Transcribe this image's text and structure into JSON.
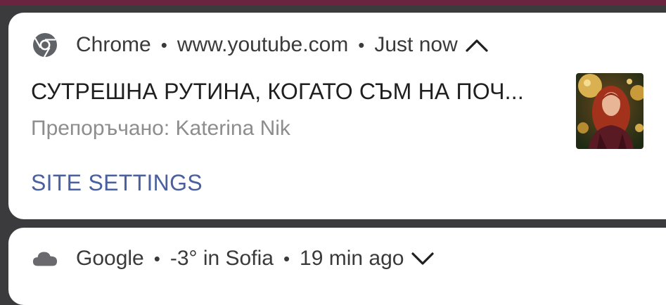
{
  "notifications": [
    {
      "app_name": "Chrome",
      "source": "www.youtube.com",
      "time": "Just now",
      "app_icon": "chrome-icon",
      "expanded": true,
      "title": "СУТРЕШНА РУТИНА, КОГАТО СЪМ НА ПОЧ...",
      "subtitle": "Препоръчано: Katerina Nik",
      "action_label": "SITE SETTINGS",
      "thumbnail": "video-thumbnail"
    },
    {
      "app_name": "Google",
      "source": "-3° in Sofia",
      "time": "19 min ago",
      "app_icon": "cloud-icon",
      "expanded": false
    }
  ],
  "separator": "•",
  "colors": {
    "background": "#3b3b3d",
    "card": "#ffffff",
    "action": "#4a5fa0",
    "top_strip": "#6b2440"
  }
}
